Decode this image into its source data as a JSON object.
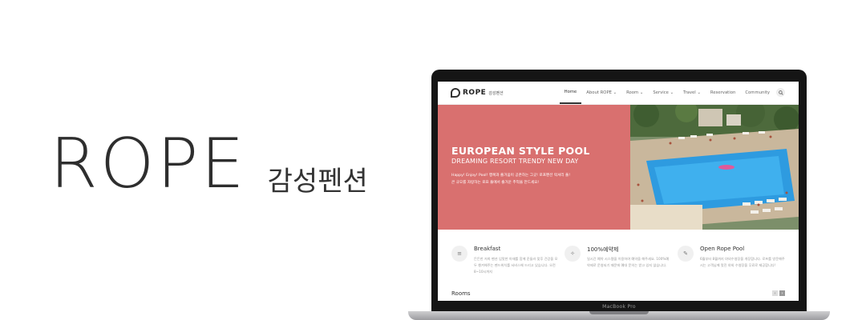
{
  "brand": {
    "name": "ROPE",
    "subtitle": "감성펜션"
  },
  "laptop": {
    "label": "MacBook Pro"
  },
  "site": {
    "logo": {
      "name": "ROPE",
      "sub": "감성펜션"
    },
    "nav": [
      {
        "label": "Home"
      },
      {
        "label": "About ROPE ⌄"
      },
      {
        "label": "Room ⌄"
      },
      {
        "label": "Service ⌄"
      },
      {
        "label": "Travel ⌄"
      },
      {
        "label": "Reservation"
      },
      {
        "label": "Community"
      }
    ],
    "hero": {
      "title": "EUROPEAN STYLE POOL",
      "subtitle": "DREAMING RESORT TRENDY NEW DAY",
      "desc_line1": "Happy! Enjoy! Pool! 행복과 즐거움이 공존하는 그곳! 로프펜션 럭셔리 풀!",
      "desc_line2": "큰 규모를 자랑하는 로프 풀에서 즐거운 추억을 만드세요!"
    },
    "features": [
      {
        "title": "Breakfast",
        "desc": "든든한 저희 펜션 입맛한 아재를 함께 준둘러 맞후 건강을 모두 챙겨해주는 펜드위치를 서비스해 드리고 있습니다. 오전 8~10시까지"
      },
      {
        "title": "100%예약제",
        "desc": "일시간 예약 시스템을 이용하여 예약을 해주세요. 100%예약제로 운영되기 때문에 예대 문의는 받고 있지 않습니다."
      },
      {
        "title": "Open Rope Pool",
        "desc": "6월부터 8월까지 야외수영장을 개장합니다. 로프를 방문해주시는 고객님께 멋진 야외 수영장을 무료로 제공합니다!"
      }
    ],
    "rooms_title": "Rooms"
  },
  "icons": {
    "search": "search-icon",
    "breakfast": "menu-icon",
    "reservation": "sparkle-icon",
    "pool": "pencil-icon"
  }
}
